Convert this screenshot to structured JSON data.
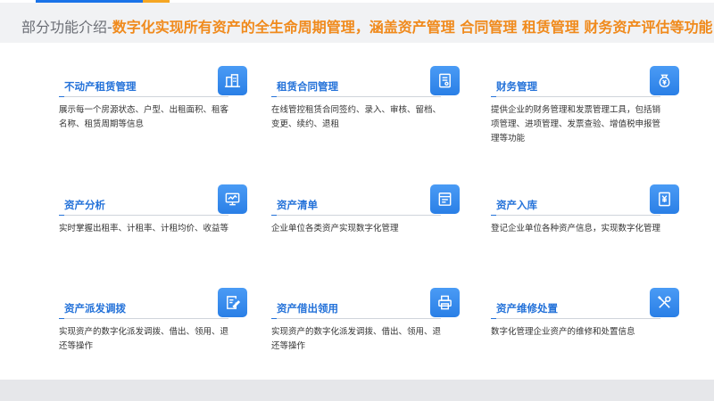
{
  "header": {
    "lead": "部分功能介绍-",
    "subtitle": "数字化实现所有资产的全生命周期管理，涵盖资产管理 合同管理 租赁管理 财务资产评估等功能"
  },
  "colors": {
    "accent_blue": "#2472d9",
    "accent_orange": "#f08a1c"
  },
  "cards": [
    {
      "title": "不动产租赁管理",
      "icon": "building-icon",
      "desc": "展示每一个房源状态、户型、出租面积、租客名称、租赁周期等信息"
    },
    {
      "title": "租赁合同管理",
      "icon": "contract-icon",
      "desc": "在线管控租赁合同签约、录入、审核、留档、变更、续约、退租"
    },
    {
      "title": "财务管理",
      "icon": "money-bag-icon",
      "desc": "提供企业的财务管理和发票管理工具，包括销项管理、进项管理、发票查验、增值税申报管理等功能"
    },
    {
      "title": "资产分析",
      "icon": "monitor-chart-icon",
      "desc": "实时掌握出租率、计租率、计租均价、收益等"
    },
    {
      "title": "资产清单",
      "icon": "list-icon",
      "desc": "企业单位各类资产实现数字化管理"
    },
    {
      "title": "资产入库",
      "icon": "yen-document-icon",
      "desc": "登记企业单位各种资产信息，实现数字化管理"
    },
    {
      "title": "资产派发调拨",
      "icon": "edit-document-icon",
      "desc": "实现资产的数字化派发调拨、借出、领用、退还等操作"
    },
    {
      "title": "资产借出领用",
      "icon": "printer-icon",
      "desc": "实现资产的数字化派发调拨、借出、领用、退还等操作"
    },
    {
      "title": "资产维修处置",
      "icon": "tools-icon",
      "desc": "数字化管理企业资产的维修和处置信息"
    }
  ]
}
